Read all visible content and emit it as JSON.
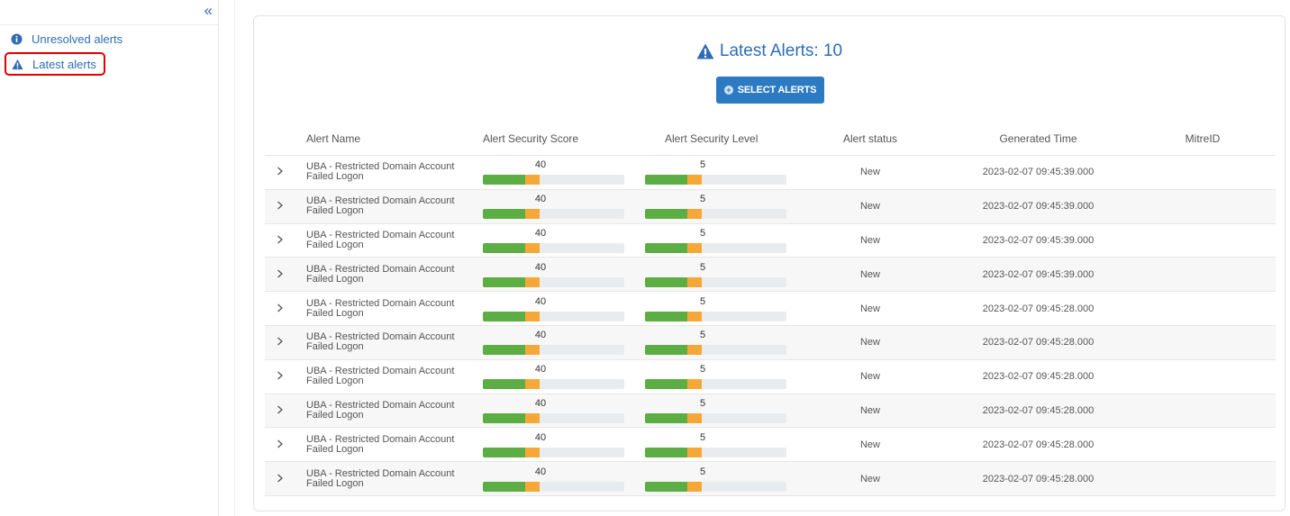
{
  "sidebar": {
    "collapse_glyph": "«",
    "items": [
      {
        "label": "Unresolved alerts",
        "icon": "info-circle-icon"
      },
      {
        "label": "Latest alerts",
        "icon": "warning-triangle-icon"
      }
    ]
  },
  "panel": {
    "title": "Latest Alerts: 10",
    "select_button": "SELECT ALERTS"
  },
  "table": {
    "columns": [
      "Alert Name",
      "Alert Security Score",
      "Alert Security Level",
      "Alert status",
      "Generated Time",
      "MitreID"
    ],
    "rows": [
      {
        "name_line1": "UBA - Restricted Domain Account",
        "name_line2": "Failed Logon",
        "score": "40",
        "level": "5",
        "status": "New",
        "time": "2023-02-07 09:45:39.000",
        "mitre": ""
      },
      {
        "name_line1": "UBA - Restricted Domain Account",
        "name_line2": "Failed Logon",
        "score": "40",
        "level": "5",
        "status": "New",
        "time": "2023-02-07 09:45:39.000",
        "mitre": ""
      },
      {
        "name_line1": "UBA - Restricted Domain Account",
        "name_line2": "Failed Logon",
        "score": "40",
        "level": "5",
        "status": "New",
        "time": "2023-02-07 09:45:39.000",
        "mitre": ""
      },
      {
        "name_line1": "UBA - Restricted Domain Account",
        "name_line2": "Failed Logon",
        "score": "40",
        "level": "5",
        "status": "New",
        "time": "2023-02-07 09:45:39.000",
        "mitre": ""
      },
      {
        "name_line1": "UBA - Restricted Domain Account",
        "name_line2": "Failed Logon",
        "score": "40",
        "level": "5",
        "status": "New",
        "time": "2023-02-07 09:45:28.000",
        "mitre": ""
      },
      {
        "name_line1": "UBA - Restricted Domain Account",
        "name_line2": "Failed Logon",
        "score": "40",
        "level": "5",
        "status": "New",
        "time": "2023-02-07 09:45:28.000",
        "mitre": ""
      },
      {
        "name_line1": "UBA - Restricted Domain Account",
        "name_line2": "Failed Logon",
        "score": "40",
        "level": "5",
        "status": "New",
        "time": "2023-02-07 09:45:28.000",
        "mitre": ""
      },
      {
        "name_line1": "UBA - Restricted Domain Account",
        "name_line2": "Failed Logon",
        "score": "40",
        "level": "5",
        "status": "New",
        "time": "2023-02-07 09:45:28.000",
        "mitre": ""
      },
      {
        "name_line1": "UBA - Restricted Domain Account",
        "name_line2": "Failed Logon",
        "score": "40",
        "level": "5",
        "status": "New",
        "time": "2023-02-07 09:45:28.000",
        "mitre": ""
      },
      {
        "name_line1": "UBA - Restricted Domain Account",
        "name_line2": "Failed Logon",
        "score": "40",
        "level": "5",
        "status": "New",
        "time": "2023-02-07 09:45:28.000",
        "mitre": ""
      }
    ],
    "bar_fill": {
      "green_fraction": 0.3,
      "orange_fraction": 0.1
    }
  },
  "colors": {
    "accent": "#2e6db4",
    "button": "#2b7ac2",
    "bar_green": "#5dad45",
    "bar_orange": "#f5a838",
    "bar_track": "#e9ecef",
    "highlight": "#e00000"
  }
}
